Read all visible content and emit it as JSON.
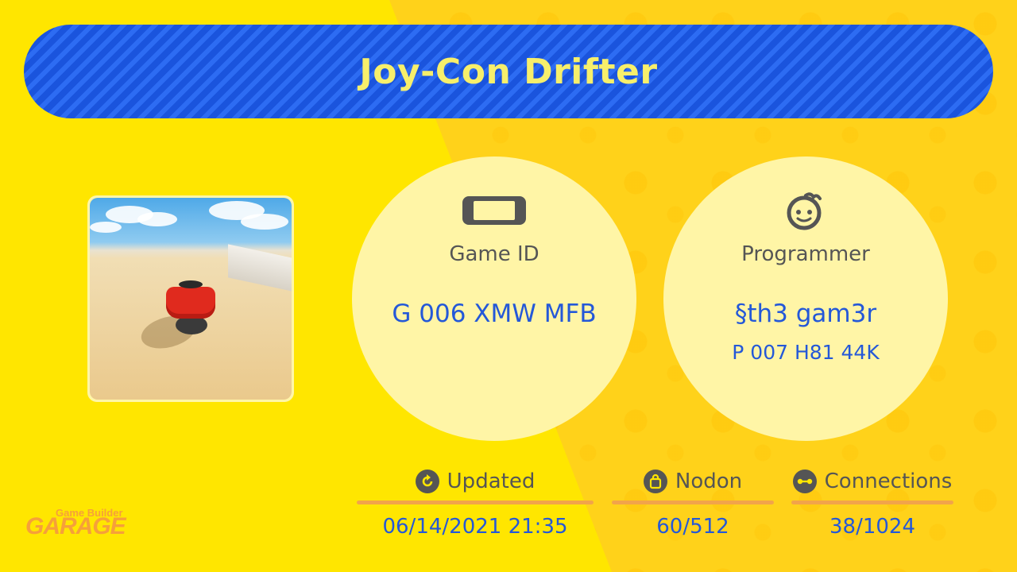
{
  "title": "Joy-Con Drifter",
  "thumbnail": {
    "alt": "Red controller on sand screenshot"
  },
  "game_id": {
    "icon": "switch-console-icon",
    "label": "Game ID",
    "value": "G 006 XMW MFB"
  },
  "programmer": {
    "icon": "face-icon",
    "label": "Programmer",
    "name": "§th3 gam3r",
    "id": "P 007 H81 44K"
  },
  "stats": {
    "updated": {
      "icon": "refresh-icon",
      "label": "Updated",
      "value": "06/14/2021 21:35"
    },
    "nodon": {
      "icon": "bag-icon",
      "label": "Nodon",
      "value": "60/512"
    },
    "connections": {
      "icon": "connection-icon",
      "label": "Connections",
      "value": "38/1024"
    }
  },
  "logo": {
    "small": "Game Builder",
    "big": "GARAGE"
  },
  "colors": {
    "background": "#FFE600",
    "banner": "#1E5AE6",
    "title_text": "#F7EF6B",
    "value_text": "#2458D8",
    "accent_bar": "#F2A44A"
  }
}
